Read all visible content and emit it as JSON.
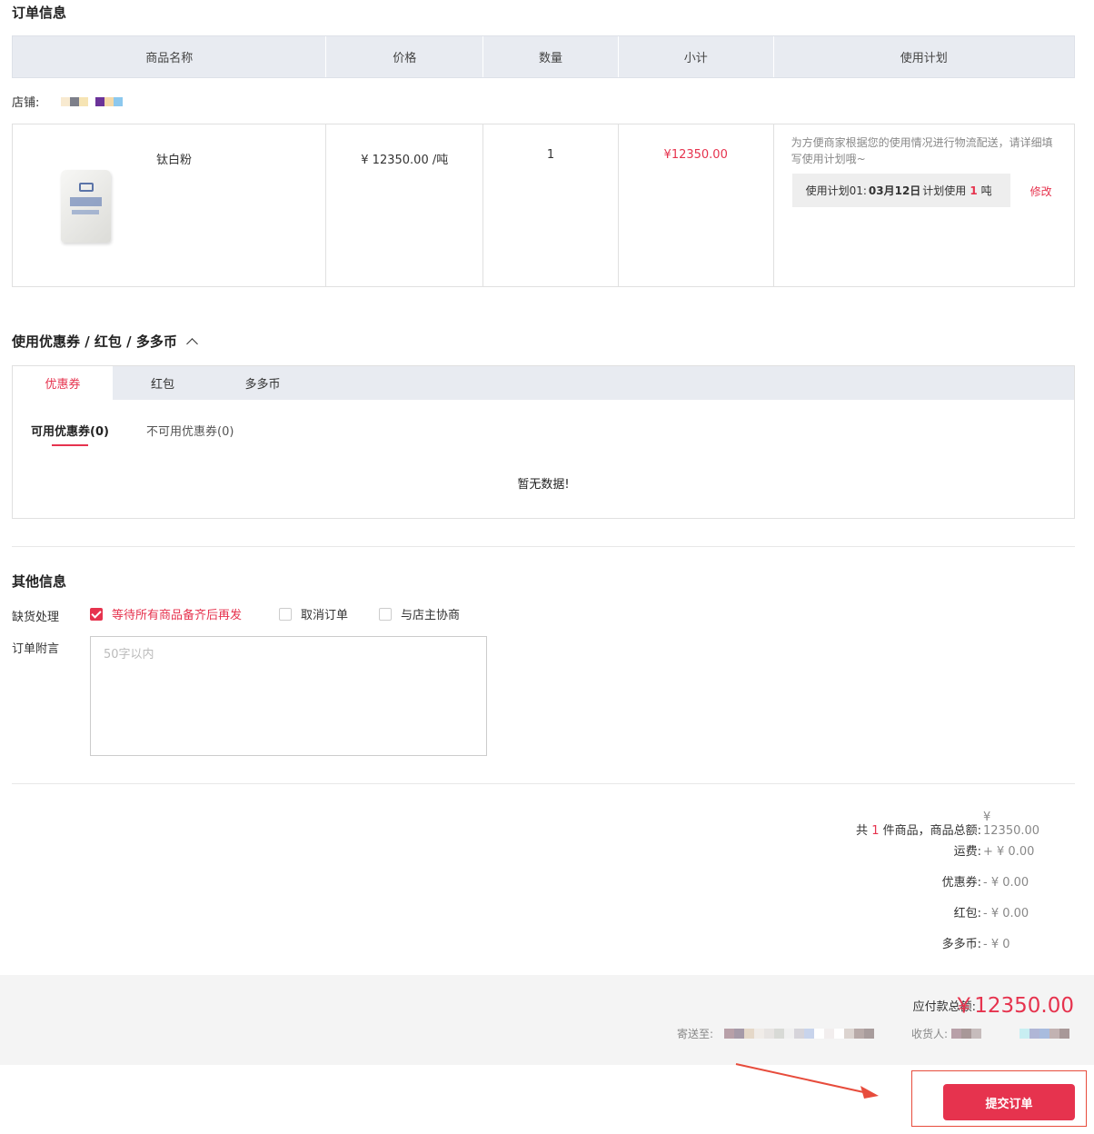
{
  "order": {
    "title": "订单信息",
    "columns": [
      "商品名称",
      "价格",
      "数量",
      "小计",
      "使用计划"
    ],
    "shop_label": "店铺:",
    "item": {
      "name": "钛白粉",
      "price": "¥ 12350.00 /吨",
      "quantity": "1",
      "subtotal": "¥12350.00",
      "plan_note": "为方便商家根据您的使用情况进行物流配送，请详细填写使用计划哦~",
      "plan_prefix": "使用计划01:",
      "plan_date": "03月12日",
      "plan_mid": "计划使用",
      "plan_qty": "1",
      "plan_unit": "吨",
      "modify_label": "修改"
    }
  },
  "coupon": {
    "title": "使用优惠券 / 红包 / 多多币",
    "tabs": [
      "优惠券",
      "红包",
      "多多币"
    ],
    "subtabs": [
      "可用优惠券(0)",
      "不可用优惠券(0)"
    ],
    "empty_text": "暂无数据!"
  },
  "other": {
    "title": "其他信息",
    "stock_label": "缺货处理",
    "options": [
      "等待所有商品备齐后再发",
      "取消订单",
      "与店主协商"
    ],
    "note_label": "订单附言",
    "note_placeholder": "50字以内"
  },
  "summary": {
    "count_prefix": "共",
    "count": "1",
    "count_suffix": "件商品，商品总额:",
    "goods_total": "¥ 12350.00",
    "shipping_label": "运费:",
    "shipping": "+ ¥ 0.00",
    "coupon_label": "优惠券:",
    "coupon": "- ¥ 0.00",
    "redpacket_label": "红包:",
    "redpacket": "- ¥ 0.00",
    "coins_label": "多多币:",
    "coins": "- ¥ 0"
  },
  "footer": {
    "payable_label": "应付款总额:",
    "payable": "￥12350.00",
    "ship_to_label": "寄送至:",
    "receiver_label": "收货人:",
    "submit_label": "提交订单"
  },
  "colors": {
    "accent": "#e6334e",
    "header_bg": "#e8ebf1",
    "footer_bg": "#f4f4f4"
  }
}
